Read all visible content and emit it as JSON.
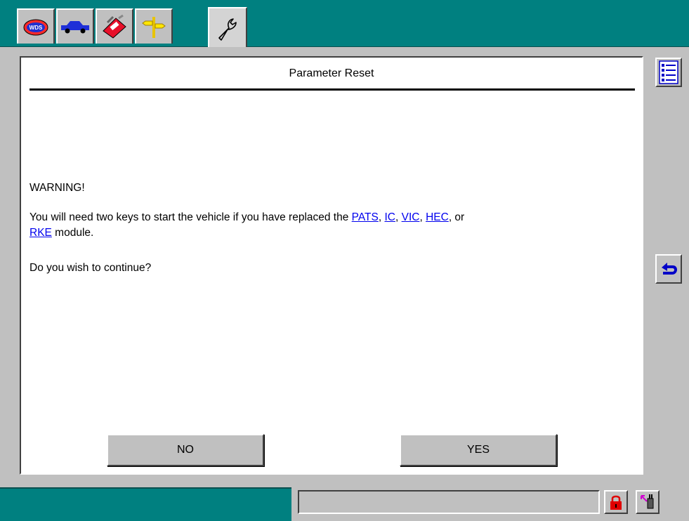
{
  "toolbar": {
    "tabs": [
      {
        "icon": "vehicle-id-badge-icon"
      },
      {
        "icon": "vehicle-car-icon"
      },
      {
        "icon": "toolbox-icon"
      },
      {
        "icon": "signpost-icon"
      },
      {
        "icon": "wrench-icon"
      }
    ]
  },
  "dialog": {
    "title": "Parameter Reset",
    "warning_label": "WARNING!",
    "message": {
      "prefix": "You will need two keys to start the vehicle if you have replaced the ",
      "links": [
        "PATS",
        "IC",
        "VIC",
        "HEC",
        "RKE"
      ],
      "sep1": ", ",
      "sep2": ", ",
      "sep3": ", ",
      "sep4": ", or",
      "suffix": " module."
    },
    "question": "Do you wish to continue?",
    "no_label": "NO",
    "yes_label": "YES"
  },
  "sidebar": {
    "list_icon": "list-icon",
    "return_icon": "return-arrow-icon"
  },
  "status": {
    "field_text": "",
    "lock_icon": "padlock-icon",
    "plug_icon": "connection-plug-icon"
  },
  "colors": {
    "teal": "#008080",
    "gray": "#c0c0c0",
    "link": "#0000ee",
    "accent_blue": "#0000c8",
    "lock_red": "#e00000"
  }
}
